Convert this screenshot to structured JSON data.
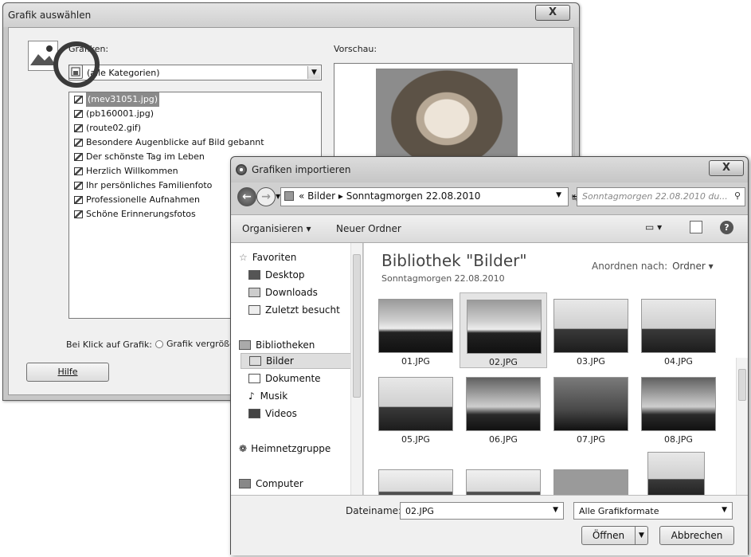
{
  "dialog_grafik": {
    "title": "Grafik auswählen",
    "close_label": "X",
    "grafiken_label": "Grafiken:",
    "category_value": "(alle Kategorien)",
    "items": [
      "(mev31051.jpg)",
      "(pb160001.jpg)",
      "(route02.gif)",
      "Besondere Augenblicke auf Bild gebannt",
      "Der schönste Tag im Leben",
      "Herzlich Willkommen",
      "Ihr persönliches Familienfoto",
      "Professionelle Aufnahmen",
      "Schöne Erinnerungsfotos"
    ],
    "selected_index": 0,
    "preview_label": "Vorschau:",
    "click_label": "Bei Klick auf Grafik:",
    "radio_label": "Grafik vergrößern",
    "help_button": "Hilfe"
  },
  "dialog_import": {
    "title": "Grafiken importieren",
    "close_label": "X",
    "breadcrumb": {
      "prefix": "«",
      "part1": "Bilder",
      "sep": "▸",
      "part2": "Sonntagmorgen 22.08.2010"
    },
    "search_placeholder": "Sonntagmorgen 22.08.2010 du...",
    "toolbar": {
      "organize": "Organisieren ▾",
      "new_folder": "Neuer Ordner"
    },
    "nav": {
      "favorites": "Favoriten",
      "desktop": "Desktop",
      "downloads": "Downloads",
      "recent": "Zuletzt besucht",
      "libraries": "Bibliotheken",
      "pictures": "Bilder",
      "documents": "Dokumente",
      "music": "Musik",
      "videos": "Videos",
      "homegroup": "Heimnetzgruppe",
      "computer": "Computer"
    },
    "library_title": "Bibliothek \"Bilder\"",
    "library_subtitle": "Sonntagmorgen 22.08.2010",
    "arrange_label": "Anordnen nach:",
    "arrange_value": "Ordner ▾",
    "files": [
      "01.JPG",
      "02.JPG",
      "03.JPG",
      "04.JPG",
      "05.JPG",
      "06.JPG",
      "07.JPG",
      "08.JPG"
    ],
    "selected_file": "02.JPG",
    "filename_label": "Dateiname:",
    "filename_value": "02.JPG",
    "filetype_value": "Alle Grafikformate",
    "open_button": "Öffnen",
    "cancel_button": "Abbrechen"
  }
}
